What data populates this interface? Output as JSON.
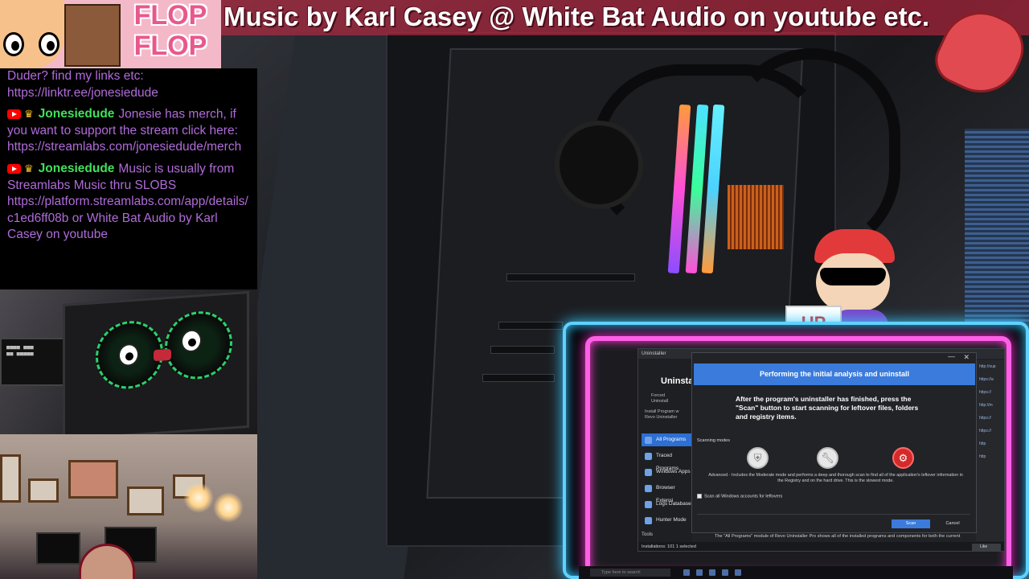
{
  "banner": {
    "music_credit": "Music by Karl Casey @ White Bat Audio on youtube etc."
  },
  "logo": {
    "text_line1": "FLOP",
    "text_line2": "FLOP"
  },
  "chat": {
    "partial_top": "Duder? find my links etc:",
    "partial_link": "https://linktr.ee/jonesiedude",
    "messages": [
      {
        "user": "Jonesiedude",
        "text": "Jonesie has merch, if you want to support the stream click here: https://streamlabs.com/jonesiedude/merch"
      },
      {
        "user": "Jonesiedude",
        "text": "Music is usually from Streamlabs Music thru SLOBS https://platform.streamlabs.com/app/details/c1ed6ff08b or White Bat Audio by Karl Casey on youtube"
      }
    ]
  },
  "kid_sign": "UP",
  "revo": {
    "window_title": "Uninstaller",
    "header_title": "Uninstal",
    "toolbar": {
      "forced_uninstall": "Forced\nUninstall",
      "install_with": "Install Program w\nRevo Uninstaller"
    },
    "nav_items": [
      {
        "label": "All Programs",
        "active": true
      },
      {
        "label": "Traced Programs",
        "active": false
      },
      {
        "label": "Windows Apps",
        "active": false
      },
      {
        "label": "Browser Extensi",
        "active": false
      },
      {
        "label": "Logs Database",
        "active": false
      },
      {
        "label": "Hunter Mode",
        "active": false
      }
    ],
    "tools_label": "Tools",
    "right_links": [
      "http://sup",
      "https://a",
      "https://",
      "http://m",
      "https://",
      "https://",
      "http",
      "http"
    ],
    "bottom_note": "The \"All Programs\" module of Revo Uninstaller Pro shows all of the installed programs and components for both the current",
    "status": "Installations: 101    1 selected",
    "like_label": "Like"
  },
  "dialog": {
    "header": "Performing the initial analysis and uninstall",
    "body": "After the program's uninstaller has finished, press the \"Scan\" button to start scanning for leftover files, folders and registry items.",
    "scanning_modes_label": "Scanning modes",
    "mode_description": "Advanced - Includes the Moderate mode and performs a deep and thorough scan to find all of the application's leftover information in the Registry and on the hard drive. This is the slowest mode.",
    "checkbox_label": "Scan all Windows accounts for leftovers",
    "scan_button": "Scan",
    "cancel_button": "Cancel",
    "modes": [
      {
        "icon": "shield-icon",
        "selected": false
      },
      {
        "icon": "wrench-icon",
        "selected": false
      },
      {
        "icon": "gears-icon",
        "selected": true
      }
    ]
  },
  "taskbar": {
    "search_placeholder": "Type here to search"
  },
  "colors": {
    "chat_user": "#41e05b",
    "chat_text": "#b06bd9",
    "dialog_accent": "#3a7bdc",
    "neon_pink": "#ff5fe6",
    "neon_blue": "#5fd1ff"
  }
}
